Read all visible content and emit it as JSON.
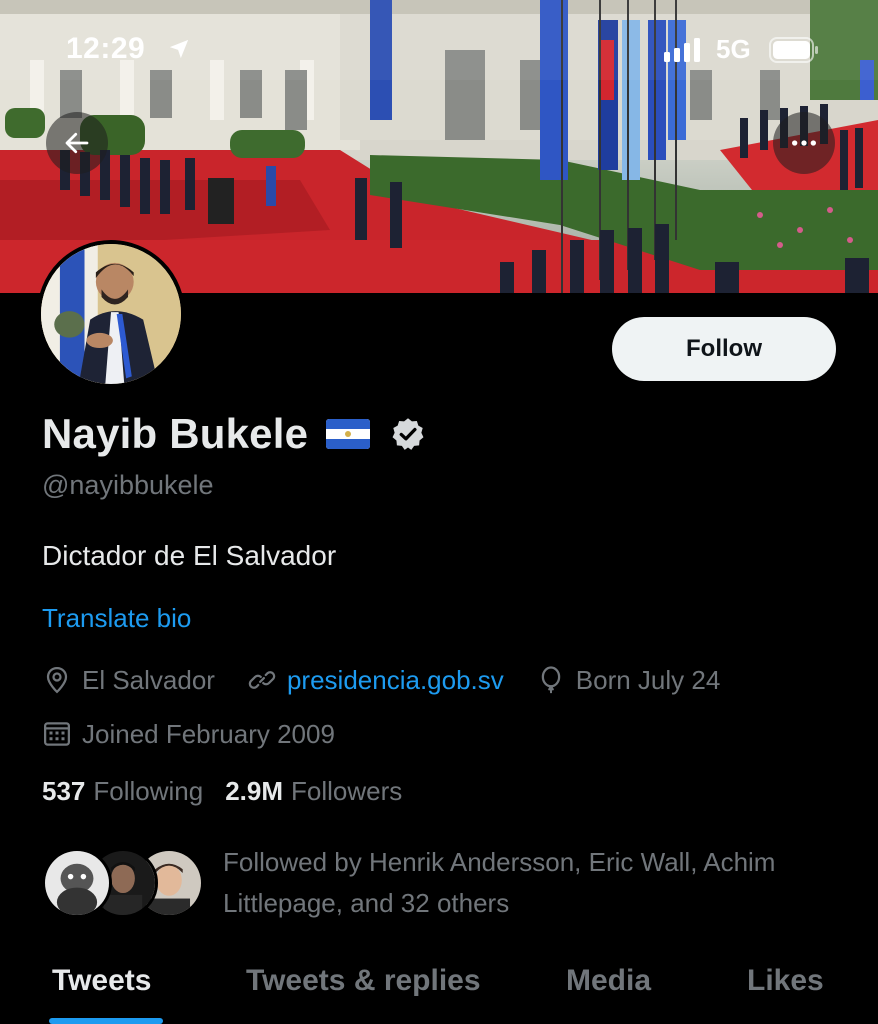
{
  "status_bar": {
    "time": "12:29",
    "network": "5G"
  },
  "header": {
    "back_icon": "arrow-left-icon",
    "more_icon": "more-horizontal-icon"
  },
  "profile": {
    "display_name": "Nayib Bukele",
    "flag_icon": "el-salvador-flag-icon",
    "verified_icon": "verified-badge-icon",
    "handle": "@nayibbukele",
    "bio": "Dictador de El Salvador",
    "translate_label": "Translate bio",
    "follow_label": "Follow",
    "location": "El Salvador",
    "website": "presidencia.gob.sv",
    "birthday": "Born July 24",
    "joined": "Joined February 2009",
    "following_count": "537",
    "following_label": "Following",
    "followers_count": "2.9M",
    "followers_label": "Followers",
    "followed_by_text": "Followed by Henrik Andersson, Eric Wall, Achim Littlepage, and 32 others"
  },
  "tabs": [
    {
      "label": "Tweets",
      "active": true
    },
    {
      "label": "Tweets & replies",
      "active": false
    },
    {
      "label": "Media",
      "active": false
    },
    {
      "label": "Likes",
      "active": false
    }
  ],
  "colors": {
    "background": "#000000",
    "accent": "#1d9bf0",
    "text_primary": "#e7e9ea",
    "text_secondary": "#71767b"
  }
}
